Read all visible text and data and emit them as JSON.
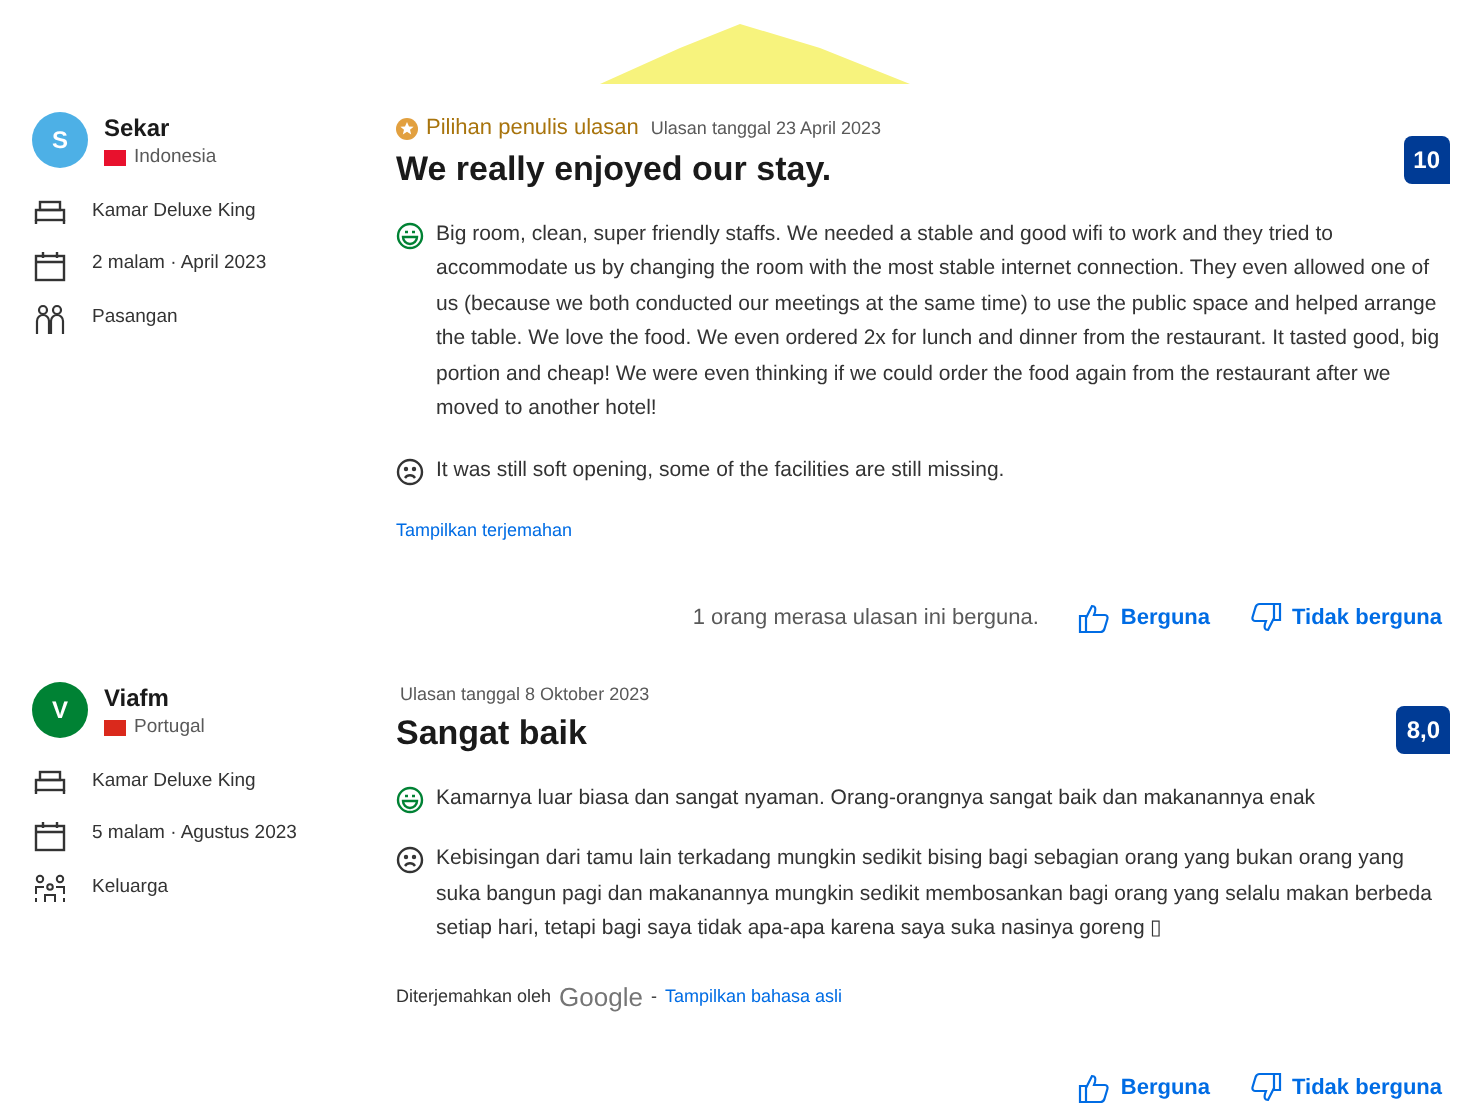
{
  "reviews": [
    {
      "avatar": {
        "letter": "S",
        "color": "#4db0e6"
      },
      "name": "Sekar",
      "country": "Indonesia",
      "flag": {
        "color": "#e8112d"
      },
      "room": "Kamar Deluxe King",
      "stay": "2 malam · April 2023",
      "traveler": {
        "label": "Pasangan",
        "kind": "couple"
      },
      "badge": "Pilihan penulis ulasan",
      "date": "Ulasan tanggal 23 April 2023",
      "title": "We really enjoyed our stay.",
      "score": "10",
      "positive": "Big room, clean, super friendly staffs. We needed a stable and good wifi to work and they tried to accommodate us by changing the room with the most stable internet connection. They even allowed one of us (because we both conducted our meetings at the same time) to use the public space and helped arrange the table. We love the food. We even ordered 2x for lunch and dinner from the restaurant. It tasted good, big portion and cheap! We were even thinking if we could order the food again from the restaurant after we moved to another hotel!",
      "negative": "It was still soft opening, some of the facilities are still missing.",
      "translate_link": "Tampilkan terjemahan",
      "helpful_count": "1 orang merasa ulasan ini berguna.",
      "helpful": "Berguna",
      "not_helpful": "Tidak berguna"
    },
    {
      "avatar": {
        "letter": "V",
        "color": "#008234"
      },
      "name": "Viafm",
      "country": "Portugal",
      "flag": {
        "color": "#da291c"
      },
      "room": "Kamar Deluxe King",
      "stay": "5 malam · Agustus 2023",
      "traveler": {
        "label": "Keluarga",
        "kind": "family"
      },
      "date": "Ulasan tanggal 8 Oktober 2023",
      "title": "Sangat baik",
      "score": "8,0",
      "positive": "Kamarnya luar biasa dan sangat nyaman. Orang-orangnya sangat baik dan makanannya enak",
      "negative": "Kebisingan dari tamu lain terkadang mungkin sedikit bising bagi sebagian orang yang bukan orang yang suka bangun pagi dan makanannya mungkin sedikit membosankan bagi orang yang selalu makan berbeda setiap hari, tetapi bagi saya tidak apa-apa karena saya suka nasinya goreng ▯",
      "translated_by": {
        "prefix": "Diterjemahkan oleh",
        "logo": "Google",
        "separator": "-"
      },
      "translate_link": "Tampilkan bahasa asli",
      "helpful": "Berguna",
      "not_helpful": "Tidak berguna"
    }
  ]
}
